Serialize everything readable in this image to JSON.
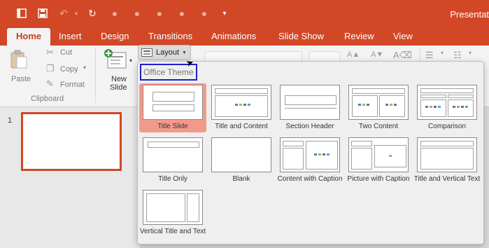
{
  "app": {
    "title": "Presentat"
  },
  "quick_access": {
    "icons": [
      "sidebar-toggle-icon",
      "save-icon",
      "undo-icon",
      "redo-icon",
      "record-icon",
      "slideshow-icon",
      "present-icon",
      "share-icon",
      "more-icon",
      "customize-icon"
    ]
  },
  "tabs": [
    {
      "label": "Home",
      "active": true
    },
    {
      "label": "Insert"
    },
    {
      "label": "Design"
    },
    {
      "label": "Transitions"
    },
    {
      "label": "Animations"
    },
    {
      "label": "Slide Show"
    },
    {
      "label": "Review"
    },
    {
      "label": "View"
    }
  ],
  "ribbon": {
    "paste": "Paste",
    "cut": "Cut",
    "copy": "Copy",
    "format": "Format",
    "clipboard_group": "Clipboard",
    "new_slide_line1": "New",
    "new_slide_line2": "Slide",
    "layout": "Layout"
  },
  "slides": [
    {
      "number": "1"
    }
  ],
  "layout_gallery": {
    "header": "Office Theme",
    "items": [
      {
        "label": "Title Slide",
        "selected": true
      },
      {
        "label": "Title and Content"
      },
      {
        "label": "Section Header"
      },
      {
        "label": "Two Content"
      },
      {
        "label": "Comparison"
      },
      {
        "label": "Title Only"
      },
      {
        "label": "Blank"
      },
      {
        "label": "Content with Caption"
      },
      {
        "label": "Picture with Caption"
      },
      {
        "label": "Title and Vertical Text"
      },
      {
        "label": "Vertical Title and Text"
      }
    ]
  },
  "colors": {
    "accent": "#d24726",
    "selected_item": "#f29a8a",
    "header_outline": "#1f1fcc",
    "content_icons": [
      "#4f81bd",
      "#9bbb59",
      "#8064a2",
      "#4bacc6"
    ]
  }
}
